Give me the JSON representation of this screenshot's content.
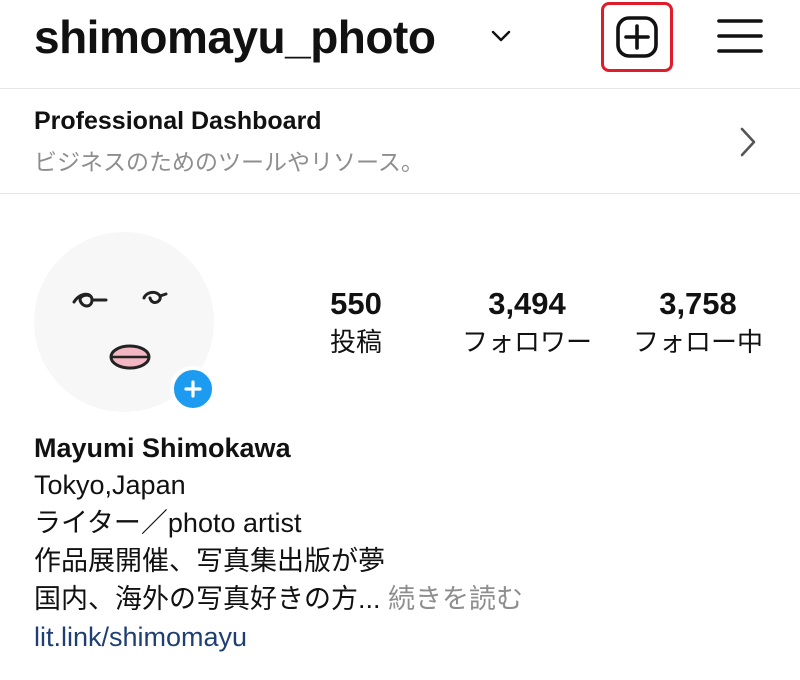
{
  "header": {
    "username": "shimomayu_photo",
    "icons": [
      "chevron-down-icon",
      "new-post-icon",
      "menu-icon"
    ]
  },
  "dashboard": {
    "title": "Professional Dashboard",
    "subtitle": "ビジネスのためのツールやリソース。",
    "icon": "chevron-right-icon"
  },
  "profile": {
    "avatar_icon": "face-avatar",
    "add_story_icon": "plus-icon",
    "stats": [
      {
        "value": "550",
        "label": "投稿"
      },
      {
        "value": "3,494",
        "label": "フォロワー"
      },
      {
        "value": "3,758",
        "label": "フォロー中"
      }
    ]
  },
  "bio": {
    "name": "Mayumi Shimokawa",
    "lines": [
      "Tokyo,Japan",
      "ライター／photo artist",
      "作品展開催、写真集出版が夢"
    ],
    "last_line": "国内、海外の写真好きの方...",
    "more": "続きを読む",
    "link": "lit.link/shimomayu"
  },
  "colors": {
    "highlight": "#e01b2a",
    "story_add": "#1d9bf0",
    "link": "#1f3f73",
    "muted": "#8e8e8e"
  }
}
